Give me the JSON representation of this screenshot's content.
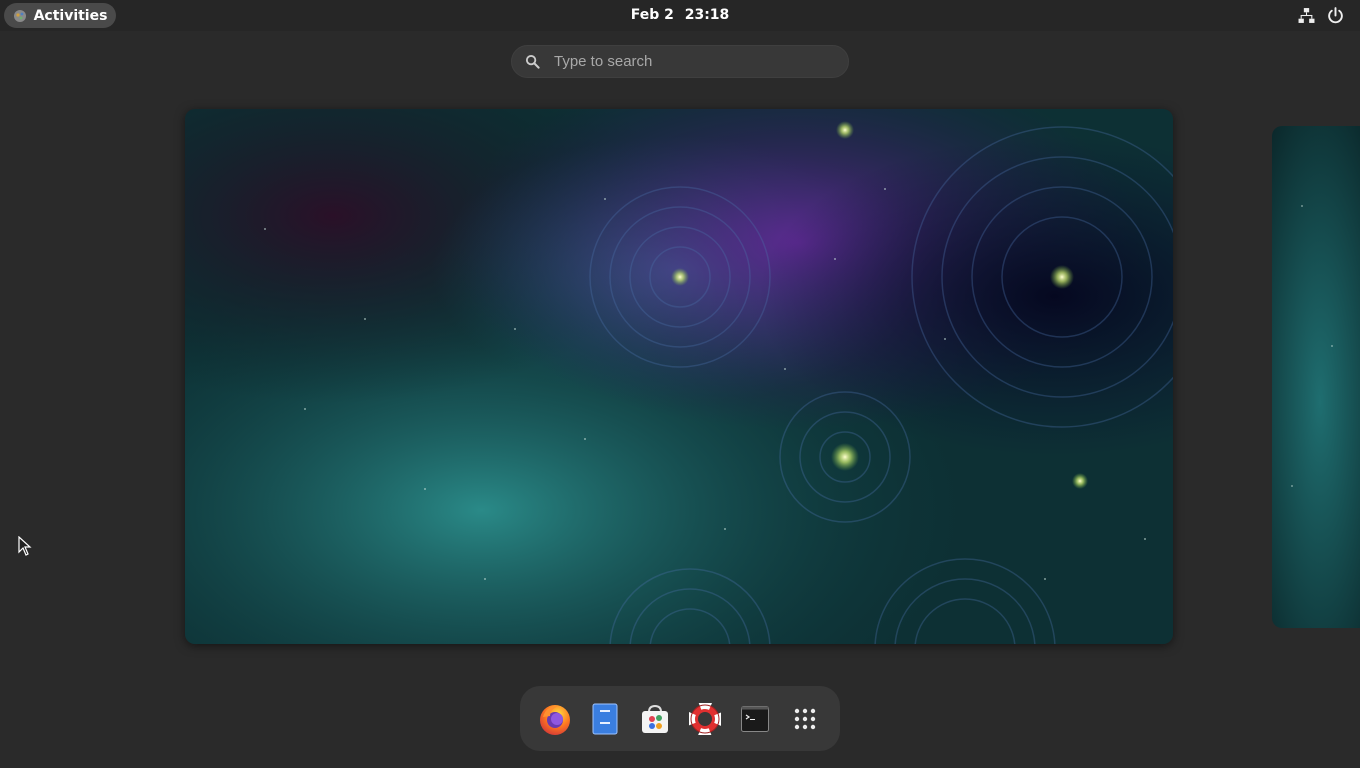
{
  "topbar": {
    "activities_label": "Activities",
    "clock_date": "Feb 2",
    "clock_time": "23:18",
    "tray_icons": [
      "network-icon",
      "power-icon"
    ]
  },
  "search": {
    "placeholder": "Type to search"
  },
  "workspaces": [
    {
      "name": "workspace-1",
      "state": "active"
    },
    {
      "name": "workspace-2",
      "state": "partial"
    }
  ],
  "dash": {
    "apps": [
      {
        "name": "firefox-icon",
        "label": "Firefox"
      },
      {
        "name": "files-icon",
        "label": "Files"
      },
      {
        "name": "software-icon",
        "label": "Software"
      },
      {
        "name": "help-icon",
        "label": "Help"
      },
      {
        "name": "terminal-icon",
        "label": "Terminal"
      },
      {
        "name": "show-apps-icon",
        "label": "Show Applications"
      }
    ]
  },
  "colors": {
    "panel": "#262626",
    "background": "#2a2a2a",
    "dash": "#383838",
    "wallpaper_teal": "#2a8a88",
    "wallpaper_purple": "#4a1f7a",
    "wallpaper_navy": "#0b1030"
  }
}
